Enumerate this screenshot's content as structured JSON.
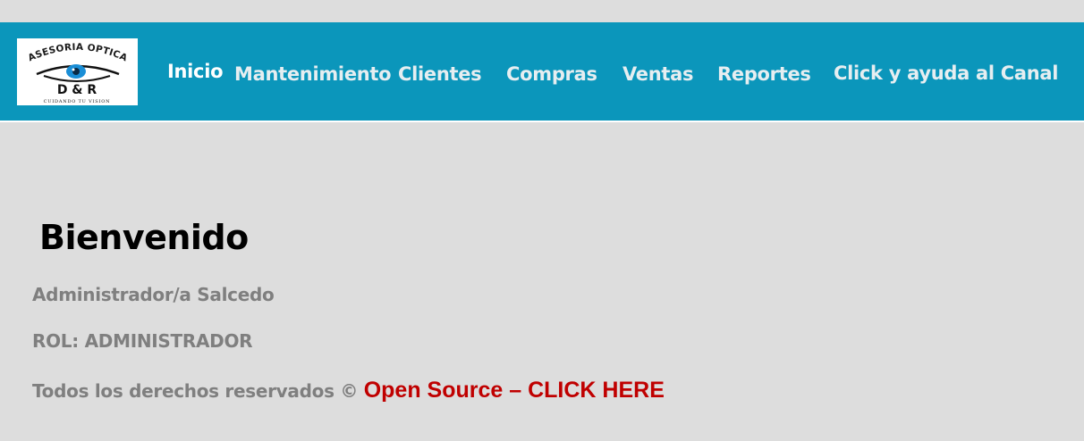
{
  "brand": {
    "logo_top_text": "ASESORIA OPTICA",
    "logo_initials": "D & R",
    "logo_tagline": "CUIDANDO TU VISION",
    "primary_color": "#0b96bb",
    "logo_eye_color": "#1a8ed6"
  },
  "nav": {
    "items": [
      {
        "label": "Inicio",
        "active": true
      },
      {
        "label": "Mantenimiento",
        "active": false
      },
      {
        "label": "Clientes",
        "active": false
      },
      {
        "label": "Compras",
        "active": false
      },
      {
        "label": "Ventas",
        "active": false
      },
      {
        "label": "Reportes",
        "active": false
      },
      {
        "label": "Click y ayuda al Canal",
        "active": false
      }
    ]
  },
  "main": {
    "title": "Bienvenido",
    "user_line": "Administrador/a Salcedo",
    "role_line": "ROL: ADMINISTRADOR",
    "rights_text": "Todos los derechos reservados ©",
    "link_text": "Open Source – CLICK HERE",
    "link_color": "#c00000"
  }
}
